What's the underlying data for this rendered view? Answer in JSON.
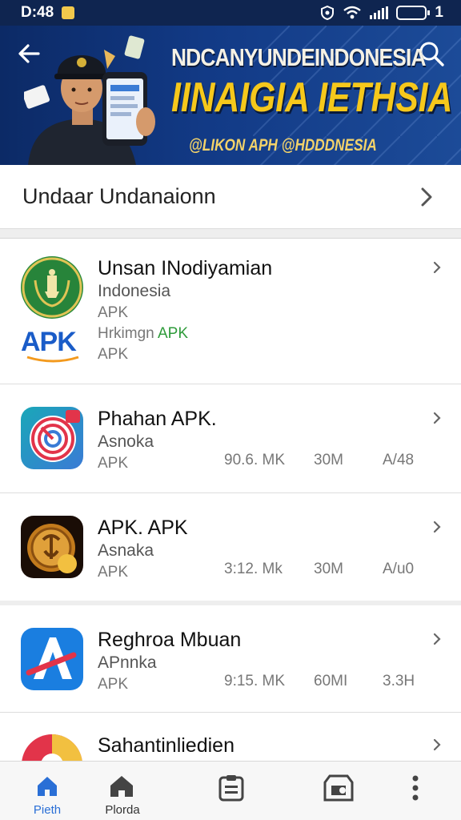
{
  "status_bar": {
    "time": "D:48",
    "right_text": "1",
    "icons": [
      "notification-icon",
      "shield-icon",
      "wifi-icon",
      "signal-icon",
      "battery-icon"
    ]
  },
  "banner": {
    "title_line1": "NDCANYUNDEINDONESIA",
    "title_line2": "IINAIGIA IETHSIA",
    "subtitle": "@LIKON APH @HDDDNESIA",
    "colors": {
      "background": "#123a86",
      "title2": "#f6c81b"
    }
  },
  "category": {
    "title": "Undaar Undanaionn"
  },
  "apps": [
    {
      "name": "Unsan INodiyamian",
      "sub": "Indonesia",
      "line3": "APK",
      "line4_prefix": "Hrkimgn",
      "line4_accent": "APK",
      "line5": "APK",
      "icon": "emblem-icon",
      "secondary_icon_text": "APK"
    },
    {
      "name": "Phahan APK.",
      "sub": "Asnoka",
      "type": "APK",
      "size": "90.6. MK",
      "downloads": "30M",
      "rating": "A/48",
      "icon": "target-icon"
    },
    {
      "name": "APK. APK",
      "sub": "Asnaka",
      "type": "APK",
      "size": "3:12. Mk",
      "downloads": "30M",
      "rating": "A/u0",
      "icon": "golden-coin-icon"
    },
    {
      "name": "Reghroa Mbuan",
      "sub": "APnnka",
      "type": "APK",
      "size": "9:15. MK",
      "downloads": "60MI",
      "rating": "3.3H",
      "icon": "letter-a-icon"
    },
    {
      "name": "Sahantinliedien",
      "icon": "colorful-circle-icon"
    }
  ],
  "bottom_nav": [
    {
      "label": "Pieth",
      "icon": "home-icon",
      "active": true
    },
    {
      "label": "Plorda",
      "icon": "home-icon",
      "active": false
    },
    {
      "label": "",
      "icon": "list-icon",
      "active": false
    },
    {
      "label": "",
      "icon": "store-icon",
      "active": false
    },
    {
      "label": "",
      "icon": "more-vertical-icon",
      "active": false
    }
  ]
}
